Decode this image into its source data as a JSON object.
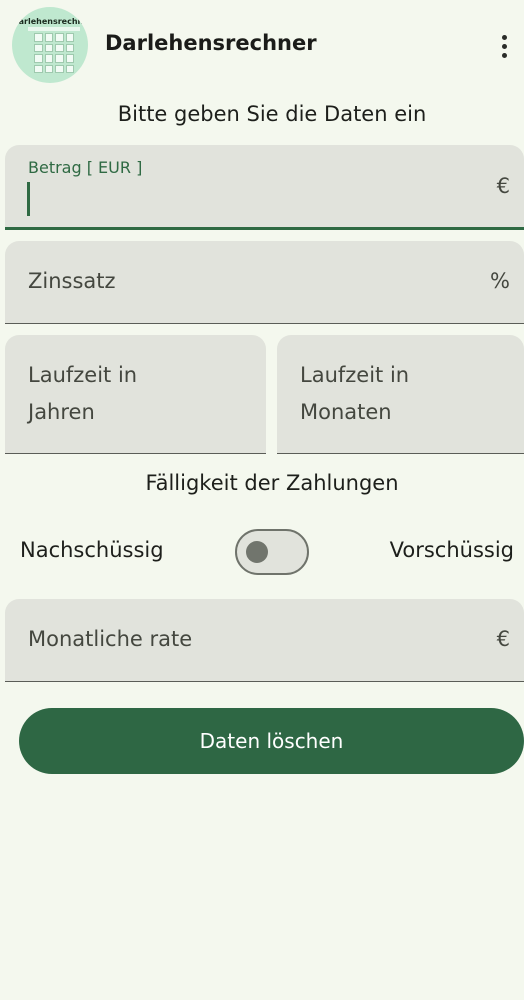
{
  "app": {
    "title": "Darlehensrechner",
    "logo_text": "Darlehensrechner",
    "menu_icon": "more-vert-icon"
  },
  "form": {
    "heading": "Bitte geben Sie die Daten ein",
    "amount": {
      "label": "Betrag [ EUR ]",
      "value": "",
      "suffix": "€"
    },
    "interest": {
      "placeholder": "Zinssatz",
      "suffix": "%"
    },
    "term_years": {
      "placeholder_line1": "Laufzeit in",
      "placeholder_line2": "Jahren"
    },
    "term_months": {
      "placeholder_line1": "Laufzeit in",
      "placeholder_line2": "Monaten"
    },
    "payment_timing": {
      "label": "Fälligkeit der Zahlungen",
      "left_option": "Nachschüssig",
      "right_option": "Vorschüssig",
      "switch_on": false
    },
    "monthly_rate": {
      "placeholder": "Monatliche rate",
      "suffix": "€"
    },
    "clear_button": "Daten löschen"
  },
  "colors": {
    "background": "#f4f8ee",
    "field": "#e1e3dc",
    "primary": "#2e6744"
  }
}
